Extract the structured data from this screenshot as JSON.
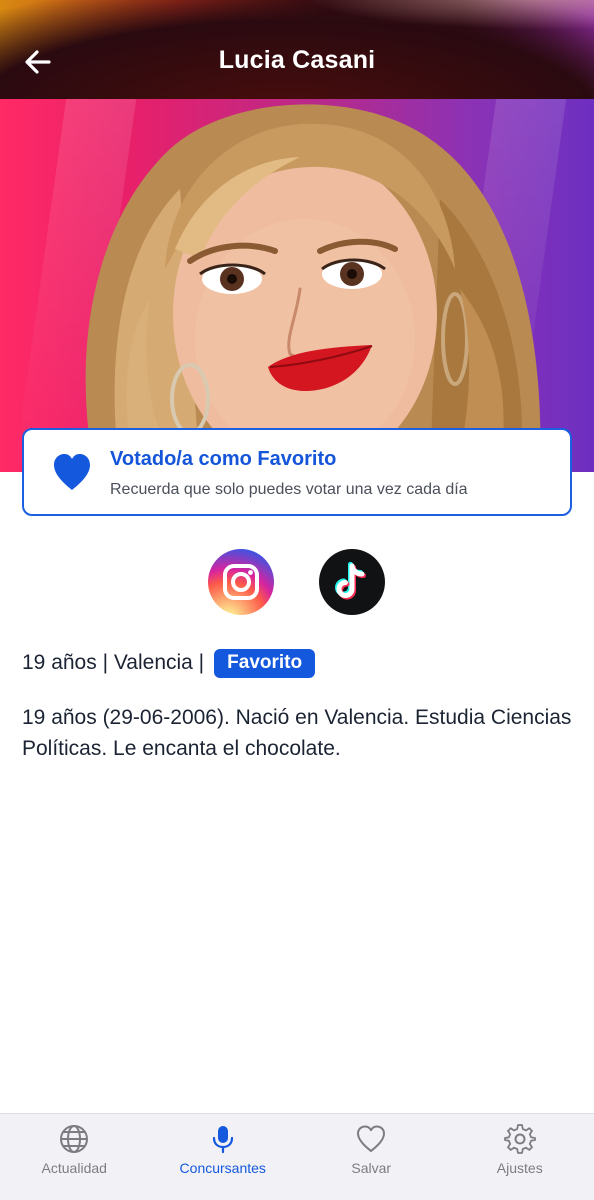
{
  "header": {
    "title": "Lucia Casani",
    "back_icon": "arrow-left-icon"
  },
  "hero": {
    "photo_description_icon": "contestant-photo"
  },
  "vote_card": {
    "icon": "heart-icon",
    "title": "Votado/a como Favorito",
    "subtitle": "Recuerda que solo puedes votar una vez cada día",
    "accent_color": "#1458dd"
  },
  "social": {
    "instagram_icon": "instagram-icon",
    "tiktok_icon": "tiktok-icon"
  },
  "info": {
    "summary": "19 años | Valencia |",
    "badge": "Favorito",
    "bio": "19 años (29-06-2006).  Nació en Valencia. Estudia Ciencias Políticas. Le encanta el chocolate."
  },
  "bottom_nav": {
    "items": [
      {
        "label": "Actualidad",
        "icon": "globe-icon",
        "active": false
      },
      {
        "label": "Concursantes",
        "icon": "microphone-icon",
        "active": true
      },
      {
        "label": "Salvar",
        "icon": "heart-outline-icon",
        "active": false
      },
      {
        "label": "Ajustes",
        "icon": "gear-icon",
        "active": false
      }
    ]
  },
  "colors": {
    "primary": "#1458dd",
    "nav_inactive": "#7c7c82",
    "text": "#1c2434"
  }
}
